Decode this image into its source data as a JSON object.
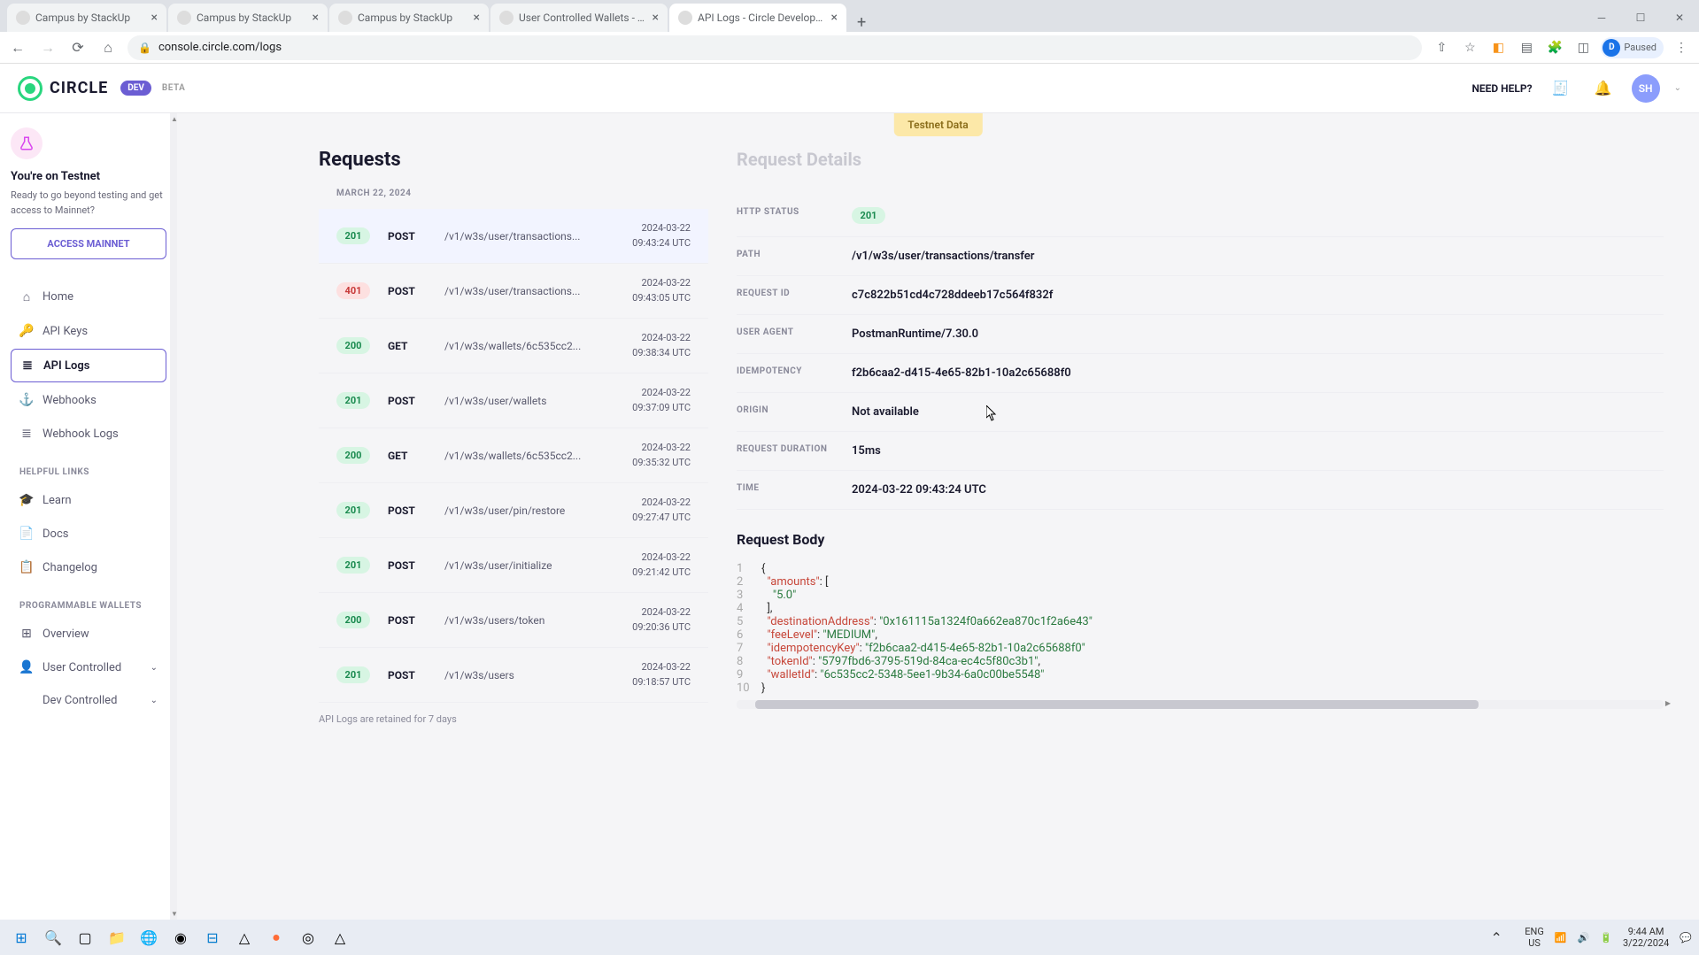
{
  "tabs": [
    {
      "title": "Campus by StackUp",
      "active": false
    },
    {
      "title": "Campus by StackUp",
      "active": false
    },
    {
      "title": "Campus by StackUp",
      "active": false
    },
    {
      "title": "User Controlled Wallets - User D",
      "active": false
    },
    {
      "title": "API Logs - Circle Developer Expe",
      "active": true
    }
  ],
  "url": "console.circle.com/logs",
  "profile": {
    "initial": "D",
    "status": "Paused"
  },
  "header": {
    "logo": "CIRCLE",
    "dev": "DEV",
    "beta": "BETA",
    "help": "NEED HELP?",
    "avatar": "SH"
  },
  "sidebar": {
    "heading": "You're on Testnet",
    "desc": "Ready to go beyond testing and get access to Mainnet?",
    "cta": "ACCESS MAINNET",
    "nav": [
      {
        "icon": "⌂",
        "label": "Home"
      },
      {
        "icon": "🔑",
        "label": "API Keys"
      },
      {
        "icon": "≣",
        "label": "API Logs",
        "active": true
      },
      {
        "icon": "⚓",
        "label": "Webhooks"
      },
      {
        "icon": "≣",
        "label": "Webhook Logs"
      }
    ],
    "section_helpful": "HELPFUL LINKS",
    "helpful": [
      {
        "icon": "🎓",
        "label": "Learn"
      },
      {
        "icon": "📄",
        "label": "Docs"
      },
      {
        "icon": "📋",
        "label": "Changelog"
      }
    ],
    "section_pw": "PROGRAMMABLE WALLETS",
    "pw": [
      {
        "icon": "⊞",
        "label": "Overview"
      },
      {
        "icon": "👤",
        "label": "User Controlled",
        "expand": true
      },
      {
        "icon": "</>",
        "label": "Dev Controlled",
        "expand": true
      }
    ]
  },
  "testnet_banner": "Testnet Data",
  "requests": {
    "title": "Requests",
    "date": "MARCH 22, 2024",
    "rows": [
      {
        "status": "201",
        "cls": "st-201",
        "method": "POST",
        "path": "/v1/w3s/user/transactions...",
        "d": "2024-03-22",
        "t": "09:43:24 UTC",
        "selected": true
      },
      {
        "status": "401",
        "cls": "st-401",
        "method": "POST",
        "path": "/v1/w3s/user/transactions...",
        "d": "2024-03-22",
        "t": "09:43:05 UTC"
      },
      {
        "status": "200",
        "cls": "st-200",
        "method": "GET",
        "path": "/v1/w3s/wallets/6c535cc2...",
        "d": "2024-03-22",
        "t": "09:38:34 UTC"
      },
      {
        "status": "201",
        "cls": "st-201",
        "method": "POST",
        "path": "/v1/w3s/user/wallets",
        "d": "2024-03-22",
        "t": "09:37:09 UTC"
      },
      {
        "status": "200",
        "cls": "st-200",
        "method": "GET",
        "path": "/v1/w3s/wallets/6c535cc2...",
        "d": "2024-03-22",
        "t": "09:35:32 UTC"
      },
      {
        "status": "201",
        "cls": "st-201",
        "method": "POST",
        "path": "/v1/w3s/user/pin/restore",
        "d": "2024-03-22",
        "t": "09:27:47 UTC"
      },
      {
        "status": "201",
        "cls": "st-201",
        "method": "POST",
        "path": "/v1/w3s/user/initialize",
        "d": "2024-03-22",
        "t": "09:21:42 UTC"
      },
      {
        "status": "200",
        "cls": "st-200",
        "method": "POST",
        "path": "/v1/w3s/users/token",
        "d": "2024-03-22",
        "t": "09:20:36 UTC"
      },
      {
        "status": "201",
        "cls": "st-201",
        "method": "POST",
        "path": "/v1/w3s/users",
        "d": "2024-03-22",
        "t": "09:18:57 UTC"
      }
    ],
    "retention": "API Logs are retained for 7 days"
  },
  "details": {
    "title": "Request Details",
    "fields": [
      {
        "label": "HTTP STATUS",
        "value": "201",
        "pill": true
      },
      {
        "label": "PATH",
        "value": "/v1/w3s/user/transactions/transfer"
      },
      {
        "label": "REQUEST ID",
        "value": "c7c822b51cd4c728ddeeb17c564f832f"
      },
      {
        "label": "USER AGENT",
        "value": "PostmanRuntime/7.30.0"
      },
      {
        "label": "IDEMPOTENCY",
        "value": "f2b6caa2-d415-4e65-82b1-10a2c65688f0"
      },
      {
        "label": "ORIGIN",
        "value": "Not available"
      },
      {
        "label": "REQUEST DURATION",
        "value": "15ms"
      },
      {
        "label": "TIME",
        "value": "2024-03-22 09:43:24 UTC"
      }
    ],
    "body_title": "Request Body",
    "body": {
      "amounts": [
        "5.0"
      ],
      "destinationAddress": "0x161115a1324f0a662ea870c1f2a6e43",
      "feeLevel": "MEDIUM",
      "idempotencyKey": "f2b6caa2-d415-4e65-82b1-10a2c65688f0",
      "tokenId": "5797fbd6-3795-519d-84ca-ec4c5f80c3b1",
      "walletId": "6c535cc2-5348-5ee1-9b34-6a0c00be5548"
    }
  },
  "taskbar": {
    "lang1": "ENG",
    "lang2": "US",
    "time": "9:44 AM",
    "date": "3/22/2024"
  }
}
